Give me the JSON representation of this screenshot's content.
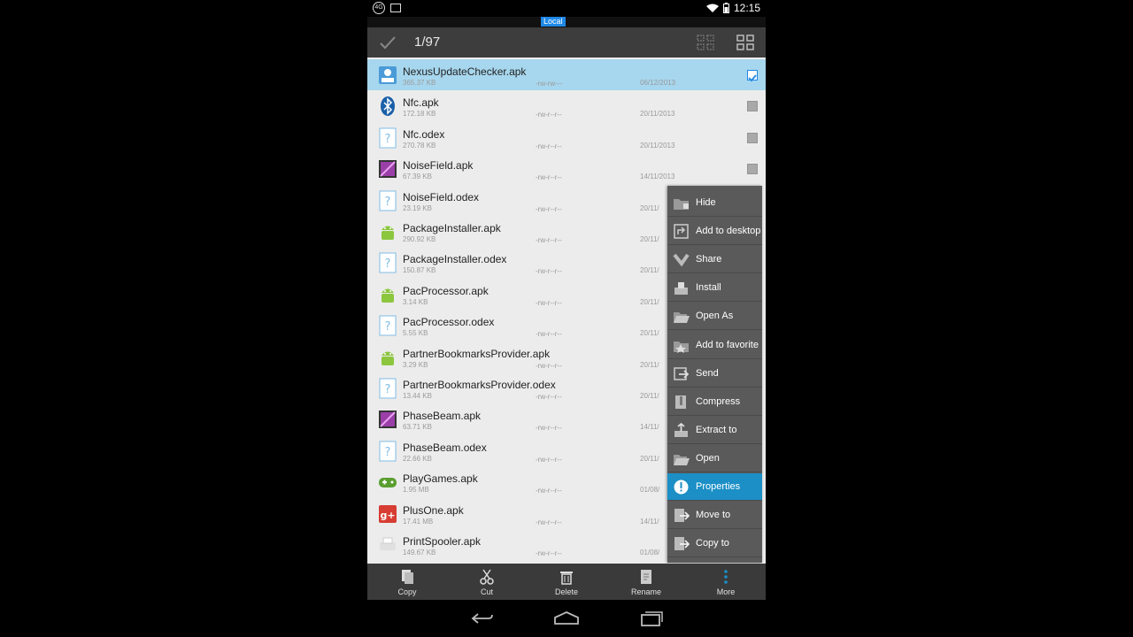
{
  "status": {
    "network": "4G",
    "time": "12:15"
  },
  "location_tag": "Local",
  "action_bar": {
    "count": "1/97"
  },
  "files": [
    {
      "name": "NexusUpdateChecker.apk",
      "size": "365.37 KB",
      "perm": "-rw-rw---",
      "date": "06/12/2013",
      "icon": "apk-icon",
      "selected": true
    },
    {
      "name": "Nfc.apk",
      "size": "172.18 KB",
      "perm": "-rw-r--r--",
      "date": "20/11/2013",
      "icon": "bluetooth-icon",
      "selected": false
    },
    {
      "name": "Nfc.odex",
      "size": "270.78 KB",
      "perm": "-rw-r--r--",
      "date": "20/11/2013",
      "icon": "unknown-file-icon",
      "selected": false
    },
    {
      "name": "NoiseField.apk",
      "size": "67.39 KB",
      "perm": "-rw-r--r--",
      "date": "14/11/2013",
      "icon": "wallpaper-icon",
      "selected": false
    },
    {
      "name": "NoiseField.odex",
      "size": "23.19 KB",
      "perm": "-rw-r--r--",
      "date": "20/11/",
      "icon": "unknown-file-icon",
      "selected": false
    },
    {
      "name": "PackageInstaller.apk",
      "size": "290.92 KB",
      "perm": "-rw-r--r--",
      "date": "20/11/",
      "icon": "android-icon",
      "selected": false
    },
    {
      "name": "PackageInstaller.odex",
      "size": "150.87 KB",
      "perm": "-rw-r--r--",
      "date": "20/11/",
      "icon": "unknown-file-icon",
      "selected": false
    },
    {
      "name": "PacProcessor.apk",
      "size": "3.14 KB",
      "perm": "-rw-r--r--",
      "date": "20/11/",
      "icon": "android-icon",
      "selected": false
    },
    {
      "name": "PacProcessor.odex",
      "size": "5.55 KB",
      "perm": "-rw-r--r--",
      "date": "20/11/",
      "icon": "unknown-file-icon",
      "selected": false
    },
    {
      "name": "PartnerBookmarksProvider.apk",
      "size": "3.29 KB",
      "perm": "-rw-r--r--",
      "date": "20/11/",
      "icon": "android-icon",
      "selected": false
    },
    {
      "name": "PartnerBookmarksProvider.odex",
      "size": "13.44 KB",
      "perm": "-rw-r--r--",
      "date": "20/11/",
      "icon": "unknown-file-icon",
      "selected": false
    },
    {
      "name": "PhaseBeam.apk",
      "size": "63.71 KB",
      "perm": "-rw-r--r--",
      "date": "14/11/",
      "icon": "wallpaper-icon",
      "selected": false
    },
    {
      "name": "PhaseBeam.odex",
      "size": "22.66 KB",
      "perm": "-rw-r--r--",
      "date": "20/11/",
      "icon": "unknown-file-icon",
      "selected": false
    },
    {
      "name": "PlayGames.apk",
      "size": "1.95 MB",
      "perm": "-rw-r--r--",
      "date": "01/08/",
      "icon": "gamepad-icon",
      "selected": false
    },
    {
      "name": "PlusOne.apk",
      "size": "17.41 MB",
      "perm": "-rw-r--r--",
      "date": "14/11/",
      "icon": "google-plus-icon",
      "selected": false
    },
    {
      "name": "PrintSpooler.apk",
      "size": "149.67 KB",
      "perm": "-rw-r--r--",
      "date": "01/08/",
      "icon": "printer-icon",
      "selected": false
    }
  ],
  "menu": [
    {
      "label": "Hide",
      "icon": "hide-folder-icon",
      "active": false
    },
    {
      "label": "Add to desktop",
      "icon": "shortcut-icon",
      "active": false
    },
    {
      "label": "Share",
      "icon": "share-icon",
      "active": false
    },
    {
      "label": "Install",
      "icon": "install-icon",
      "active": false
    },
    {
      "label": "Open As",
      "icon": "open-folder-icon",
      "active": false
    },
    {
      "label": "Add to favorite",
      "icon": "star-folder-icon",
      "active": false
    },
    {
      "label": "Send",
      "icon": "send-icon",
      "active": false
    },
    {
      "label": "Compress",
      "icon": "compress-icon",
      "active": false
    },
    {
      "label": "Extract to",
      "icon": "extract-icon",
      "active": false
    },
    {
      "label": "Open",
      "icon": "open-folder-icon",
      "active": false
    },
    {
      "label": "Properties",
      "icon": "info-icon",
      "active": true
    },
    {
      "label": "Move to",
      "icon": "move-icon",
      "active": false
    },
    {
      "label": "Copy to",
      "icon": "copy-to-icon",
      "active": false
    }
  ],
  "bottom_bar": [
    {
      "label": "Copy",
      "icon": "copy-icon"
    },
    {
      "label": "Cut",
      "icon": "scissors-icon"
    },
    {
      "label": "Delete",
      "icon": "trash-icon"
    },
    {
      "label": "Rename",
      "icon": "rename-icon"
    },
    {
      "label": "More",
      "icon": "more-icon"
    }
  ],
  "colors": {
    "accent": "#1b8fc6",
    "selected_row": "#a7d7ee",
    "menu_bg": "#5a5a5a",
    "list_bg": "#ececec"
  }
}
